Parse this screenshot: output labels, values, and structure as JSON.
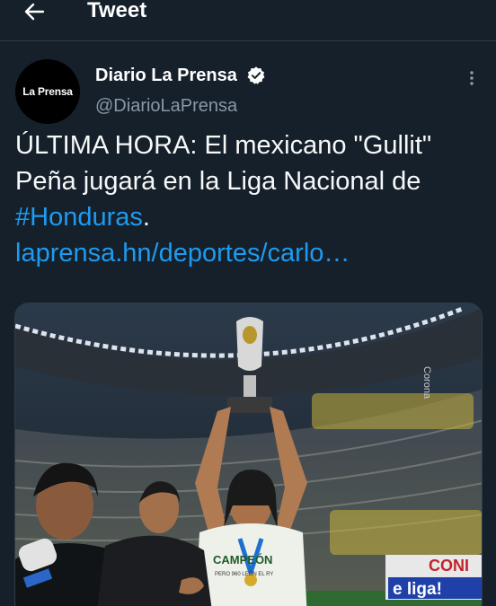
{
  "header": {
    "back_icon": "arrow-left-icon",
    "title": "Tweet"
  },
  "tweet": {
    "avatar_text": "La Prensa",
    "display_name": "Diario La Prensa",
    "verified_icon": "verified-badge-icon",
    "handle": "@DiarioLaPrensa",
    "more_icon": "more-vertical-icon",
    "text_before": "ÚLTIMA HORA: El mexicano \"Gullit\" Peña jugará en la Liga Nacional de ",
    "hashtag": "#Honduras",
    "text_after": ".",
    "link": "laprensa.hn/deportes/carlo…"
  },
  "media": {
    "jersey_text_1": "CAMPEÓN",
    "jersey_text_2": "PERO 960 LEÓN EL RY",
    "billboard_text_1": "CONI",
    "billboard_text_2": "e liga!",
    "stadium_sign": "Corona"
  },
  "colors": {
    "background": "#15202b",
    "accent": "#1d9bf0",
    "secondary_text": "#8b98a5",
    "divider": "#2f3b47"
  }
}
